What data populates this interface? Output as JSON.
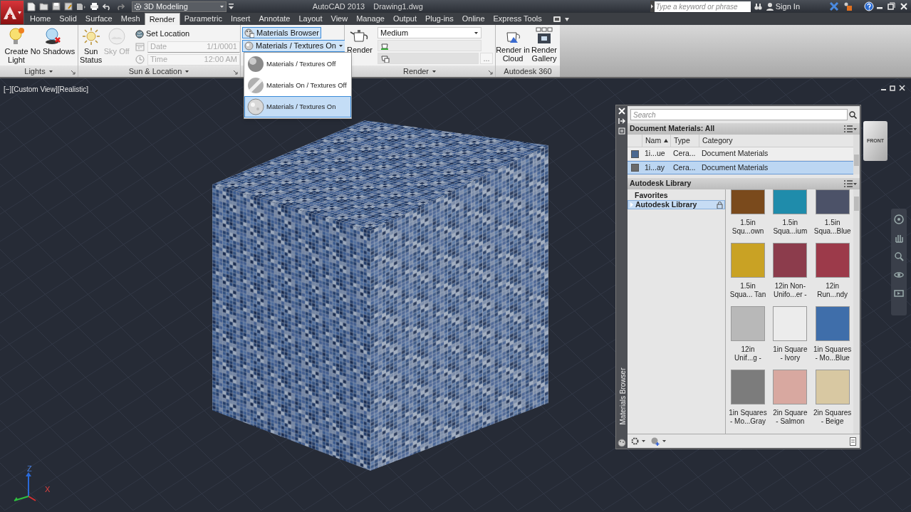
{
  "title_bar": {
    "workspace": "3D Modeling",
    "title": "AutoCAD 2013",
    "file": "Drawing1.dwg",
    "search_placeholder": "Type a keyword or phrase",
    "sign_in": "Sign In"
  },
  "tabs": [
    {
      "label": "Home",
      "selected": false
    },
    {
      "label": "Solid",
      "selected": false
    },
    {
      "label": "Surface",
      "selected": false
    },
    {
      "label": "Mesh",
      "selected": false
    },
    {
      "label": "Render",
      "selected": true
    },
    {
      "label": "Parametric",
      "selected": false
    },
    {
      "label": "Insert",
      "selected": false
    },
    {
      "label": "Annotate",
      "selected": false
    },
    {
      "label": "Layout",
      "selected": false
    },
    {
      "label": "View",
      "selected": false
    },
    {
      "label": "Manage",
      "selected": false
    },
    {
      "label": "Output",
      "selected": false
    },
    {
      "label": "Plug-ins",
      "selected": false
    },
    {
      "label": "Online",
      "selected": false
    },
    {
      "label": "Express Tools",
      "selected": false
    }
  ],
  "ribbon": {
    "lights": {
      "title": "Lights",
      "create_light": "Create Light",
      "no_shadows": "No Shadows"
    },
    "sun": {
      "title": "Sun & Location",
      "sun_status": "Sun Status",
      "sky_off": {
        "label": "Sky Off",
        "disabled": true
      },
      "set_location": "Set Location",
      "date": {
        "label": "Date",
        "value": "1/1/0001",
        "disabled": true
      },
      "time": {
        "label": "Time",
        "value": "12:00 AM",
        "disabled": true
      }
    },
    "materials": {
      "browser": {
        "label": "Materials Browser",
        "on": true
      },
      "mode": "Materials / Textures On",
      "menu": [
        {
          "label": "Materials / Textures Off",
          "selected": false
        },
        {
          "label": "Materials On / Textures Off",
          "selected": false
        },
        {
          "label": "Materials / Textures On",
          "selected": true
        }
      ]
    },
    "render": {
      "title": "Render",
      "button": "Render",
      "quality": "Medium",
      "browse": "..."
    },
    "a360": {
      "title": "Autodesk 360",
      "render_in_cloud": "Render in Cloud",
      "render_gallery": "Render Gallery"
    }
  },
  "viewport": {
    "label": "[−][Custom View][Realistic]",
    "viewcube": "FRONT",
    "axis_x": "X",
    "axis_z": "Z"
  },
  "materials_browser": {
    "side_label": "Materials Browser",
    "search_placeholder": "Search",
    "document": {
      "title": "Document Materials: All",
      "columns": [
        "Nam",
        "Type",
        "Category"
      ],
      "rows": [
        {
          "name": "1i...ue",
          "type": "Cera...",
          "category": "Document Materials",
          "color": "#4a6890",
          "selected": false
        },
        {
          "name": "1i...ay",
          "type": "Cera...",
          "category": "Document Materials",
          "color": "#6a6a6a",
          "selected": true
        }
      ]
    },
    "library": {
      "title": "Autodesk Library",
      "tree": [
        {
          "label": "Favorites",
          "selected": false
        },
        {
          "label": "Autodesk Library",
          "selected": true
        }
      ],
      "swatches": [
        {
          "lines": [
            "1.5in",
            "Squ...own"
          ],
          "color": "#7a4a1c"
        },
        {
          "lines": [
            "1.5in",
            "Squa...ium"
          ],
          "color": "#1f8cab"
        },
        {
          "lines": [
            "1.5in",
            "Squa...Blue"
          ],
          "color": "#4c5268"
        },
        {
          "lines": [
            "1.5in",
            "Squa... Tan"
          ],
          "color": "#c9a224"
        },
        {
          "lines": [
            "12in Non-",
            "Unifo...er -"
          ],
          "color": "#8c3c4c"
        },
        {
          "lines": [
            "12in",
            "Run...ndy"
          ],
          "color": "#9c3a4a"
        },
        {
          "lines": [
            "12in",
            "Unif...g -"
          ],
          "color": "#b8b8b8"
        },
        {
          "lines": [
            "1in Square",
            "- Ivory"
          ],
          "color": "#ececec"
        },
        {
          "lines": [
            "1in Squares",
            "- Mo...Blue"
          ],
          "color": "#3f6eaa"
        },
        {
          "lines": [
            "1in Squares",
            "- Mo...Gray"
          ],
          "color": "#7c7c7c"
        },
        {
          "lines": [
            "2in Square",
            "- Salmon"
          ],
          "color": "#d8a8a0"
        },
        {
          "lines": [
            "2in Squares",
            "- Beige"
          ],
          "color": "#d8c8a2"
        }
      ]
    }
  }
}
